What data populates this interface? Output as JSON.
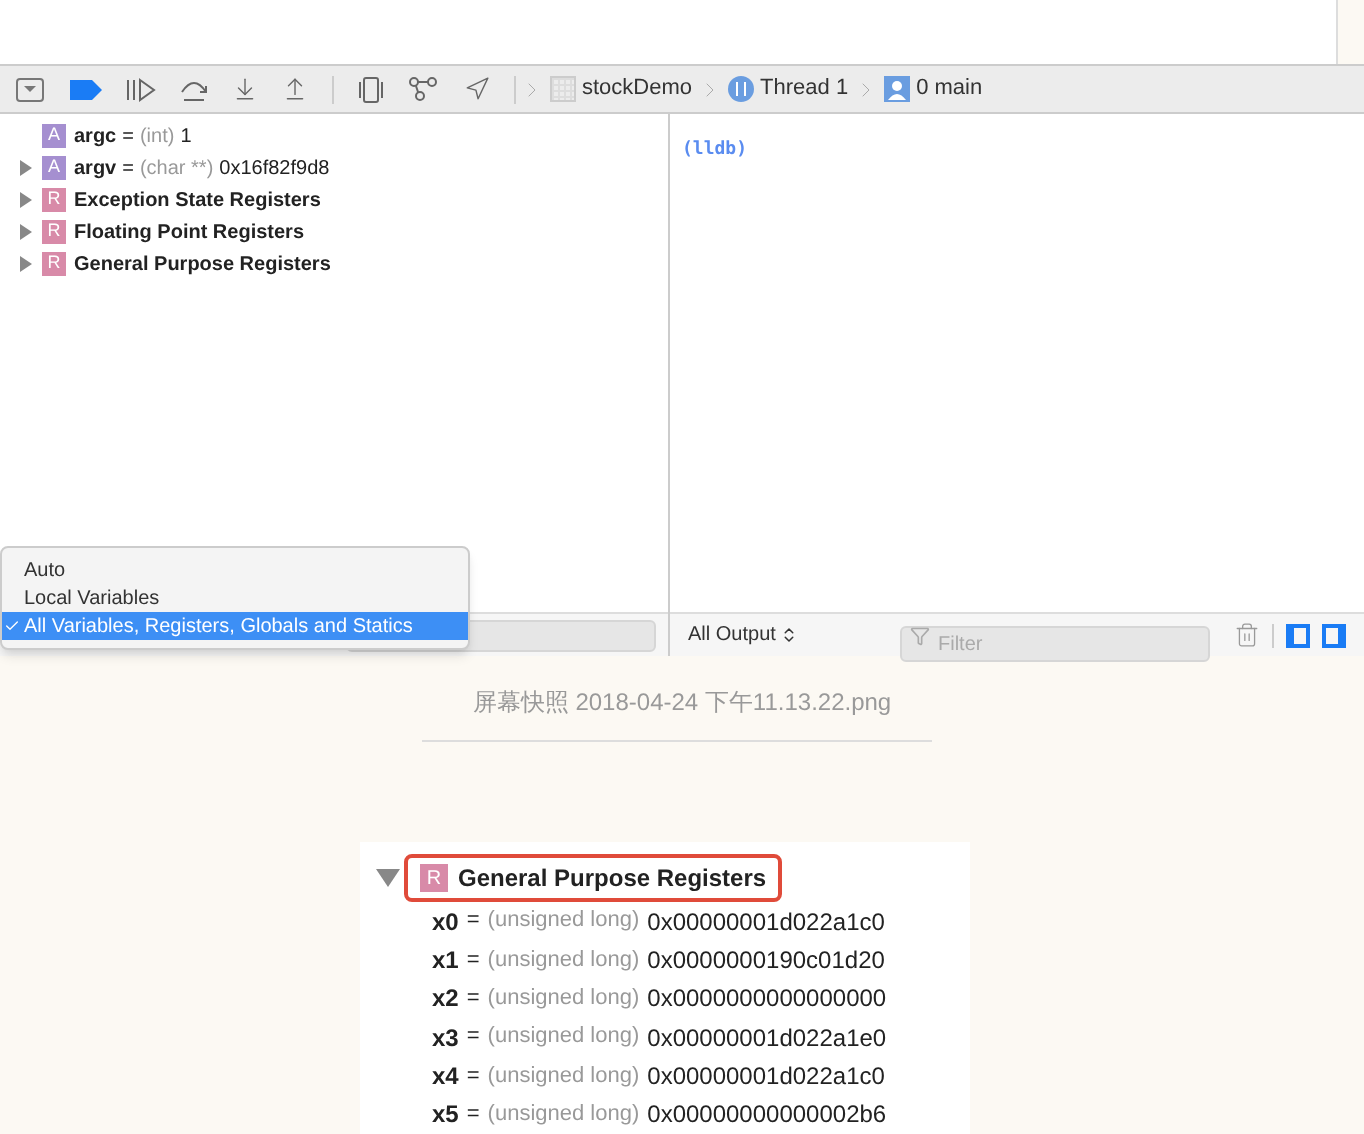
{
  "breadcrumbs": [
    {
      "label": "stockDemo",
      "kind": "project"
    },
    {
      "label": "Thread 1",
      "kind": "thread"
    },
    {
      "label": "0 main",
      "kind": "frame"
    }
  ],
  "variables": [
    {
      "kind": "argument",
      "badge": "A",
      "name": "argc",
      "operator": "=",
      "type": "(int)",
      "value": "1",
      "expandable": false
    },
    {
      "kind": "argument",
      "badge": "A",
      "name": "argv",
      "operator": "=",
      "type": "(char **)",
      "value": "0x16f82f9d8",
      "expandable": true,
      "expanded": false
    },
    {
      "kind": "register_set",
      "badge": "R",
      "name": "Exception State Registers",
      "expandable": true,
      "expanded": false
    },
    {
      "kind": "register_set",
      "badge": "R",
      "name": "Floating Point Registers",
      "expandable": true,
      "expanded": false
    },
    {
      "kind": "register_set",
      "badge": "R",
      "name": "General Purpose Registers",
      "expandable": true,
      "expanded": false
    }
  ],
  "scope_menu": [
    {
      "label": "Auto",
      "selected": false
    },
    {
      "label": "Local Variables",
      "selected": false
    },
    {
      "label": "All Variables, Registers, Globals and Statics",
      "selected": true
    }
  ],
  "console": {
    "prompt": "(lldb)",
    "output_selector": "All Output",
    "filter": {
      "placeholder": "Filter"
    }
  },
  "caption": "屏幕快照 2018-04-24 下午11.13.22.png",
  "zoomed_image": {
    "group": {
      "badge": "R",
      "label": "General Purpose Registers",
      "expanded": true,
      "highlighted": true
    },
    "registers": [
      {
        "name": "x0",
        "operator": "=",
        "type": "(unsigned long)",
        "value": "0x00000001d022a1c0"
      },
      {
        "name": "x1",
        "operator": "=",
        "type": "(unsigned long)",
        "value": "0x0000000190c01d20"
      },
      {
        "name": "x2",
        "operator": "=",
        "type": "(unsigned long)",
        "value": "0x0000000000000000"
      },
      {
        "name": "x3",
        "operator": "=",
        "type": "(unsigned long)",
        "value": "0x00000001d022a1e0"
      },
      {
        "name": "x4",
        "operator": "=",
        "type": "(unsigned long)",
        "value": "0x00000001d022a1c0"
      },
      {
        "name": "x5",
        "operator": "=",
        "type": "(unsigned long)",
        "value": "0x00000000000002b6"
      }
    ]
  }
}
